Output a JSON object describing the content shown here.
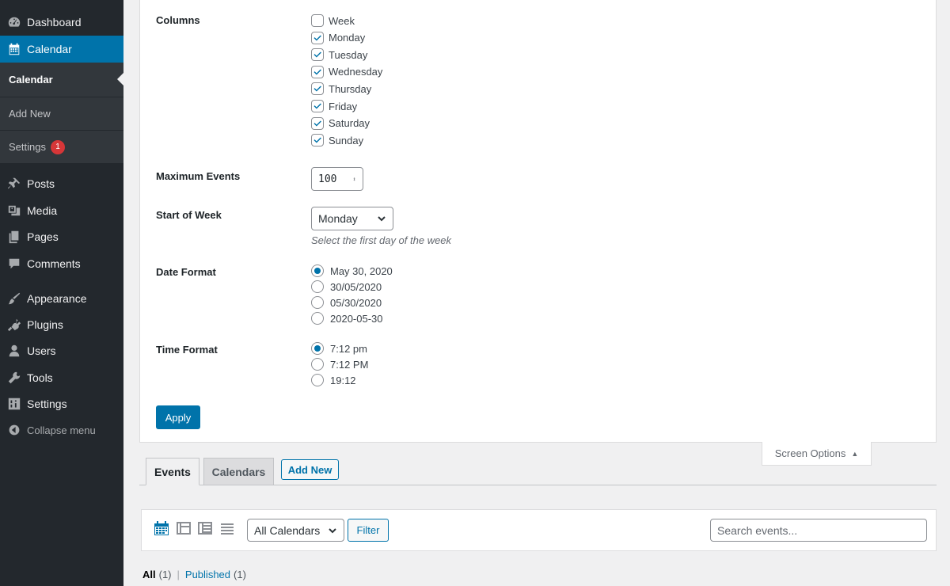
{
  "sidebar": {
    "items": [
      {
        "label": "Dashboard",
        "icon": "dashboard-icon"
      },
      {
        "label": "Calendar",
        "icon": "calendar-icon"
      },
      {
        "label": "Posts",
        "icon": "pin-icon"
      },
      {
        "label": "Media",
        "icon": "media-icon"
      },
      {
        "label": "Pages",
        "icon": "pages-icon"
      },
      {
        "label": "Comments",
        "icon": "comment-icon"
      },
      {
        "label": "Appearance",
        "icon": "brush-icon"
      },
      {
        "label": "Plugins",
        "icon": "plugin-icon"
      },
      {
        "label": "Users",
        "icon": "user-icon"
      },
      {
        "label": "Tools",
        "icon": "wrench-icon"
      },
      {
        "label": "Settings",
        "icon": "settings-icon"
      }
    ],
    "submenu": [
      {
        "label": "Calendar"
      },
      {
        "label": "Add New"
      },
      {
        "label": "Settings",
        "badge": "1"
      }
    ],
    "collapse_label": "Collapse menu"
  },
  "settings": {
    "columns": {
      "label": "Columns",
      "options": [
        {
          "label": "Week",
          "checked": false
        },
        {
          "label": "Monday",
          "checked": true
        },
        {
          "label": "Tuesday",
          "checked": true
        },
        {
          "label": "Wednesday",
          "checked": true
        },
        {
          "label": "Thursday",
          "checked": true
        },
        {
          "label": "Friday",
          "checked": true
        },
        {
          "label": "Saturday",
          "checked": true
        },
        {
          "label": "Sunday",
          "checked": true
        }
      ]
    },
    "max_events": {
      "label": "Maximum Events",
      "value": "100"
    },
    "start_of_week": {
      "label": "Start of Week",
      "value": "Monday",
      "hint": "Select the first day of the week"
    },
    "date_format": {
      "label": "Date Format",
      "options": [
        {
          "label": "May 30, 2020",
          "selected": true
        },
        {
          "label": "30/05/2020",
          "selected": false
        },
        {
          "label": "05/30/2020",
          "selected": false
        },
        {
          "label": "2020-05-30",
          "selected": false
        }
      ]
    },
    "time_format": {
      "label": "Time Format",
      "options": [
        {
          "label": "7:12 pm",
          "selected": true
        },
        {
          "label": "7:12 PM",
          "selected": false
        },
        {
          "label": "19:12",
          "selected": false
        }
      ]
    },
    "apply_label": "Apply"
  },
  "screen_options_label": "Screen Options",
  "tabs": [
    {
      "label": "Events",
      "active": true
    },
    {
      "label": "Calendars",
      "active": false
    }
  ],
  "add_new_label": "Add New",
  "filter": {
    "calendar_select": "All Calendars",
    "filter_label": "Filter",
    "search_placeholder": "Search events..."
  },
  "views": {
    "all_label": "All",
    "all_count": "(1)",
    "separator": "|",
    "published_label": "Published",
    "published_count": "(1)"
  },
  "colors": {
    "sidebar_bg": "#23282d",
    "accent": "#0073aa",
    "badge": "#d63638"
  }
}
